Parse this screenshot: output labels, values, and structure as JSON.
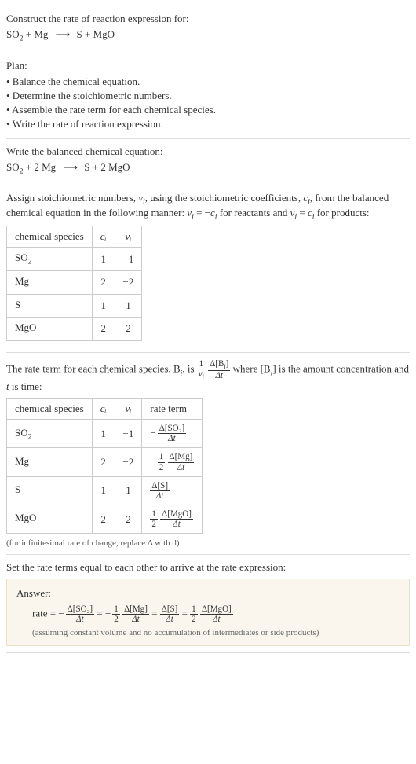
{
  "prompt": {
    "title": "Construct the rate of reaction expression for:",
    "equation_lhs": "SO",
    "equation_lhs_sub": "2",
    "equation_plus1": " + Mg ",
    "equation_arrow": "⟶",
    "equation_rhs": " S + MgO"
  },
  "plan": {
    "title": "Plan:",
    "items": [
      "• Balance the chemical equation.",
      "• Determine the stoichiometric numbers.",
      "• Assemble the rate term for each chemical species.",
      "• Write the rate of reaction expression."
    ]
  },
  "balanced": {
    "title": "Write the balanced chemical equation:",
    "eq_part1": "SO",
    "eq_sub1": "2",
    "eq_part2": " + 2 Mg ",
    "eq_arrow": "⟶",
    "eq_part3": " S + 2 MgO"
  },
  "stoich": {
    "intro_1": "Assign stoichiometric numbers, ",
    "nu_i": "ν",
    "nu_i_sub": "i",
    "intro_2": ", using the stoichiometric coefficients, ",
    "c_i": "c",
    "c_i_sub": "i",
    "intro_3": ", from the balanced chemical equation in the following manner: ",
    "rel1_lhs": "ν",
    "rel1_lhs_sub": "i",
    "rel1_eq": " = −",
    "rel1_rhs": "c",
    "rel1_rhs_sub": "i",
    "rel1_end": " for reactants and ",
    "rel2_lhs": "ν",
    "rel2_lhs_sub": "i",
    "rel2_eq": " = ",
    "rel2_rhs": "c",
    "rel2_rhs_sub": "i",
    "rel2_end": " for products:",
    "table": {
      "headers": [
        "chemical species",
        "cᵢ",
        "νᵢ"
      ],
      "rows": [
        {
          "species_main": "SO",
          "species_sub": "2",
          "c": "1",
          "nu": "−1"
        },
        {
          "species_main": "Mg",
          "species_sub": "",
          "c": "2",
          "nu": "−2"
        },
        {
          "species_main": "S",
          "species_sub": "",
          "c": "1",
          "nu": "1"
        },
        {
          "species_main": "MgO",
          "species_sub": "",
          "c": "2",
          "nu": "2"
        }
      ]
    }
  },
  "rate_term": {
    "intro_1": "The rate term for each chemical species, B",
    "intro_sub1": "i",
    "intro_2": ", is ",
    "frac1_num": "1",
    "frac1_den_main": "ν",
    "frac1_den_sub": "i",
    "frac2_num_main": "Δ[B",
    "frac2_num_sub": "i",
    "frac2_num_end": "]",
    "frac2_den": "Δt",
    "intro_3": " where [B",
    "intro_sub2": "i",
    "intro_4": "] is the amount concentration and ",
    "t_var": "t",
    "intro_5": " is time:",
    "table": {
      "headers": [
        "chemical species",
        "cᵢ",
        "νᵢ",
        "rate term"
      ],
      "rows": [
        {
          "species_main": "SO",
          "species_sub": "2",
          "c": "1",
          "nu": "−1",
          "rt_prefix": "−",
          "rt_coef_num": "",
          "rt_coef_den": "",
          "rt_num": "Δ[SO₂]",
          "rt_den": "Δt"
        },
        {
          "species_main": "Mg",
          "species_sub": "",
          "c": "2",
          "nu": "−2",
          "rt_prefix": "−",
          "rt_coef_num": "1",
          "rt_coef_den": "2",
          "rt_num": "Δ[Mg]",
          "rt_den": "Δt"
        },
        {
          "species_main": "S",
          "species_sub": "",
          "c": "1",
          "nu": "1",
          "rt_prefix": "",
          "rt_coef_num": "",
          "rt_coef_den": "",
          "rt_num": "Δ[S]",
          "rt_den": "Δt"
        },
        {
          "species_main": "MgO",
          "species_sub": "",
          "c": "2",
          "nu": "2",
          "rt_prefix": "",
          "rt_coef_num": "1",
          "rt_coef_den": "2",
          "rt_num": "Δ[MgO]",
          "rt_den": "Δt"
        }
      ]
    },
    "note": "(for infinitesimal rate of change, replace Δ with d)"
  },
  "final": {
    "title": "Set the rate terms equal to each other to arrive at the rate expression:",
    "answer_label": "Answer:",
    "rate_label": "rate = ",
    "t1_prefix": "−",
    "t1_num": "Δ[SO₂]",
    "t1_den": "Δt",
    "eq1": " = ",
    "t2_prefix": "−",
    "t2_coef_num": "1",
    "t2_coef_den": "2",
    "t2_num": "Δ[Mg]",
    "t2_den": "Δt",
    "eq2": " = ",
    "t3_num": "Δ[S]",
    "t3_den": "Δt",
    "eq3": " = ",
    "t4_coef_num": "1",
    "t4_coef_den": "2",
    "t4_num": "Δ[MgO]",
    "t4_den": "Δt",
    "note": "(assuming constant volume and no accumulation of intermediates or side products)"
  }
}
